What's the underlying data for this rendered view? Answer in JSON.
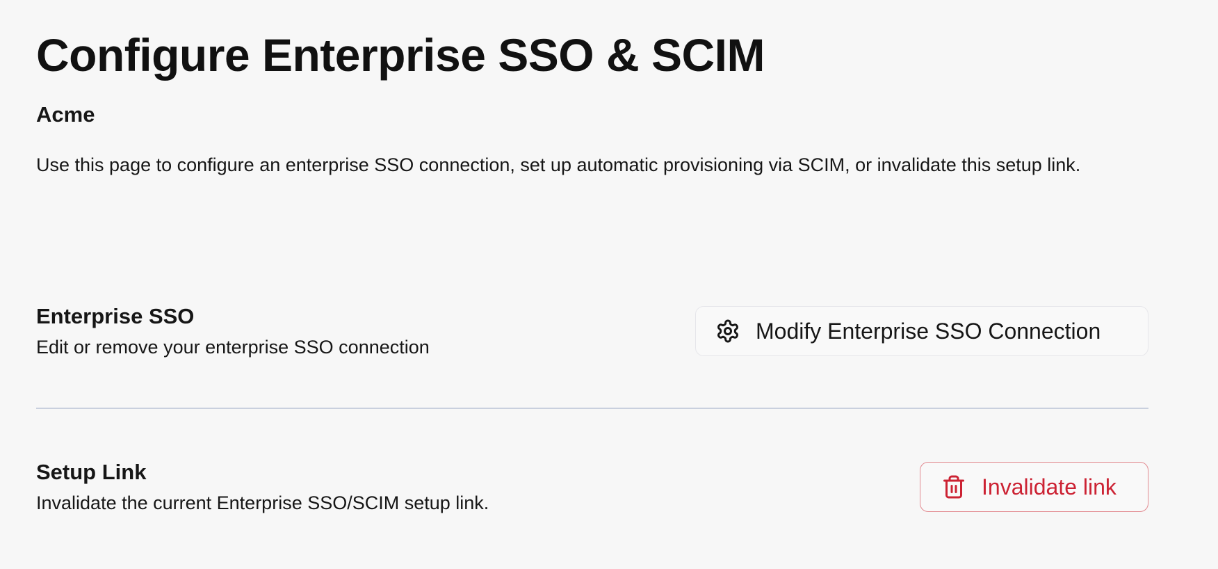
{
  "page": {
    "title": "Configure Enterprise SSO & SCIM",
    "org_name": "Acme",
    "intro": "Use this page to configure an enterprise SSO connection, set up automatic provisioning via SCIM, or invalidate this setup link."
  },
  "sections": {
    "enterprise_sso": {
      "title": "Enterprise SSO",
      "description": "Edit or remove your enterprise SSO connection",
      "button_label": "Modify Enterprise SSO Connection",
      "button_icon": "gear-icon"
    },
    "setup_link": {
      "title": "Setup Link",
      "description": "Invalidate the current Enterprise SSO/SCIM setup link.",
      "button_label": "Invalidate link",
      "button_icon": "trash-icon"
    }
  },
  "colors": {
    "background": "#f7f7f7",
    "text": "#161616",
    "danger": "#cc2233",
    "danger_border": "#e28a90",
    "divider": "#c9d0de"
  }
}
